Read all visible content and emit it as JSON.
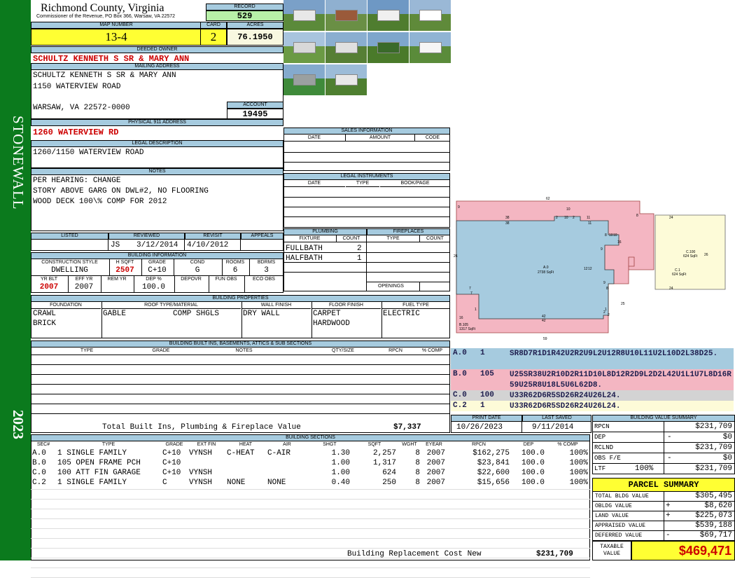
{
  "sidebar": {
    "district": "STONEWALL",
    "year": "2023"
  },
  "county": {
    "title": "Richmond County, Virginia",
    "subtitle": "Commissioner of the Revenue, PO Box 366, Warsaw, VA 22572"
  },
  "record": {
    "label": "RECORD",
    "value": "529"
  },
  "map": {
    "label": "MAP NUMBER",
    "value": "13-4"
  },
  "card": {
    "label": "CARD",
    "value": "2"
  },
  "acres": {
    "label": "ACRES",
    "value": "76.1950"
  },
  "owner": {
    "label": "DEEDED OWNER",
    "value": "SCHULTZ KENNETH S SR & MARY ANN"
  },
  "mailing": {
    "label": "MAILING ADDRESS",
    "line1": "SCHULTZ KENNETH S SR & MARY ANN",
    "line2": "1150 WATERVIEW ROAD",
    "line3": "WARSAW, VA 22572-0000"
  },
  "account": {
    "label": "ACCOUNT",
    "value": "19495"
  },
  "address911": {
    "label": "PHYSICAL 911 ADDRESS",
    "value": "1260 WATERVIEW RD"
  },
  "legal": {
    "label": "LEGAL DESCRIPTION",
    "value": "1260/1150  WATERVIEW ROAD"
  },
  "notes": {
    "label": "NOTES",
    "line1": "PER HEARING: CHANGE",
    "line2": "STORY ABOVE GARG ON DWL#2, NO FLOORING",
    "line3": "WOOD DECK 100\\% COMP FOR 2012"
  },
  "dates": {
    "listed_label": "LISTED",
    "reviewed_label": "REVIEWED",
    "revisit_label": "REVISIT",
    "appeals_label": "APPEALS",
    "reviewer": "JS",
    "reviewed": "3/12/2014",
    "revisit": "4/10/2012"
  },
  "building_info": {
    "label": "BUILDING INFORMATION",
    "h": [
      "CONSTRUCTION STYLE",
      "H SQFT",
      "GRADE",
      "COND",
      "ROOMS",
      "BDRMS"
    ],
    "v": [
      "DWELLING",
      "2507",
      "C+10",
      "G",
      "6",
      "3"
    ],
    "h2": [
      "YR BLT",
      "EFF YR",
      "REM YR",
      "DEP %",
      "DEPOVR",
      "FUN OBS",
      "ECO OBS"
    ],
    "v2": [
      "2007",
      "2007",
      "",
      "100.0",
      "",
      "",
      ""
    ]
  },
  "sales": {
    "label": "SALES INFORMATION",
    "h": [
      "DATE",
      "AMOUNT",
      "CODE"
    ]
  },
  "instruments": {
    "label": "LEGAL INSTRUMENTS",
    "h": [
      "DATE",
      "TYPE",
      "BOOK/PAGE"
    ]
  },
  "plumbing": {
    "label": "PLUMBING",
    "h": [
      "FIXTURE",
      "COUNT"
    ],
    "rows": [
      {
        "fixture": "FULLBATH",
        "count": "2"
      },
      {
        "fixture": "HALFBATH",
        "count": "1"
      }
    ]
  },
  "fireplaces": {
    "label": "FIREPLACES",
    "h": [
      "TYPE",
      "COUNT"
    ],
    "openings": "OPENINGS"
  },
  "properties": {
    "label": "BUILDING PROPERTIES",
    "h": [
      "FOUNDATION",
      "ROOF TYPE/MATERIAL",
      "WALL FINISH",
      "FLOOR FINISH",
      "FUEL TYPE"
    ],
    "foundation": [
      "CRAWL",
      "BRICK"
    ],
    "roof_type": "GABLE",
    "roof_mat": "COMP SHGLS",
    "wall": "DRY WALL",
    "floor": [
      "CARPET",
      "HARDWOOD"
    ],
    "fuel": "ELECTRIC"
  },
  "builtins": {
    "label": "BUILDING BUILT INS, BASEMENTS, ATTICS & SUB SECTIONS",
    "h": [
      "TYPE",
      "GRADE",
      "NOTES",
      "QTY/SIZE",
      "RPCN",
      "% COMP"
    ],
    "total_label": "Total Built Ins, Plumbing & Fireplace Value",
    "total": "$7,337"
  },
  "print": {
    "print_label": "PRINT DATE",
    "saved_label": "LAST SAVED",
    "print_date": "10/26/2023",
    "last_saved": "9/11/2014"
  },
  "sections": {
    "label": "BUILDING SECTIONS",
    "h": [
      "SEC#",
      "TYPE",
      "GRADE",
      "EXT FIN",
      "HEAT",
      "AIR",
      "SHGT",
      "SQFT",
      "WGHT",
      "EYEAR",
      "RPCN",
      "DEP",
      "% COMP"
    ],
    "rows": [
      [
        "A.0",
        "1 SINGLE FAMILY",
        "C+10",
        "VYNSH",
        "C-HEAT",
        "C-AIR",
        "1.30",
        "2,257",
        "8",
        "2007",
        "$162,275",
        "100.0",
        "100%"
      ],
      [
        "B.0",
        "105 OPEN FRAME PCH",
        "C+10",
        "",
        "",
        "",
        "1.00",
        "1,317",
        "8",
        "2007",
        "$23,841",
        "100.0",
        "100%"
      ],
      [
        "C.0",
        "100 ATT FIN GARAGE",
        "C+10",
        "VYNSH",
        "",
        "",
        "1.00",
        "624",
        "8",
        "2007",
        "$22,600",
        "100.0",
        "100%"
      ],
      [
        "C.2",
        "1 SINGLE FAMILY",
        "C",
        "VYNSH",
        "NONE",
        "NONE",
        "0.40",
        "250",
        "8",
        "2007",
        "$15,656",
        "100.0",
        "100%"
      ]
    ],
    "replacement_label": "Building Replacement Cost New",
    "replacement": "$231,709"
  },
  "sketch_codes": [
    {
      "sec": "A.0",
      "n": "1",
      "code": "SR8D7R1D1R42U2R2U9L2U12R8U10L11U2L10D2L38D25.",
      "color": "#a6cbdf"
    },
    {
      "sec": "B.0",
      "n": "105",
      "code": "U25SR38U2R10D2R11D10L8D12R2D9L2D2L42U1L1U7L8D16R59U25R8U18L5U6L62D8.",
      "color": "#f4b6c2"
    },
    {
      "sec": "C.0",
      "n": "100",
      "code": "U33R62D6R5SD26R24U26L24.",
      "color": "#d3d3d3"
    },
    {
      "sec": "C.2",
      "n": "1",
      "code": "U33R62D6R5SD26R24U26L24.",
      "color": "#fdfbd8"
    }
  ],
  "sketch": {
    "a_label": "A.0",
    "a_area": "2738 SqFt",
    "b_label": "B.105",
    "b_area": "1317 SqFt",
    "c_label": "C.100",
    "c_area": "624 SqFt",
    "c2_label": "C.1",
    "c2_area": "624 SqFt",
    "dims": [
      "62",
      "10",
      "9",
      "38",
      "38",
      "2",
      "10",
      "2",
      "11",
      "11",
      "8",
      "24",
      "10",
      "10",
      "16",
      "26",
      "26",
      "8",
      "9",
      "12",
      "12",
      "25",
      "9",
      "8",
      "7",
      "7",
      "2",
      "2",
      "1",
      "1",
      "42",
      "42",
      "16",
      "59",
      "24"
    ]
  },
  "value_summary": {
    "label": "BUILDING VALUE SUMMARY",
    "rows": [
      {
        "k": "RPCN",
        "op": "",
        "v": "$231,709"
      },
      {
        "k": "DEP",
        "op": "-",
        "v": "$0"
      },
      {
        "k": "RCLND",
        "op": "",
        "v": "$231,709"
      },
      {
        "k": "OBS F/E",
        "op": "-",
        "v": "$0"
      },
      {
        "k": "LTF",
        "op": "100%",
        "v": "$231,709"
      }
    ]
  },
  "parcel": {
    "label": "PARCEL SUMMARY",
    "rows": [
      {
        "k": "TOTAL BLDG VALUE",
        "op": "",
        "v": "$305,495"
      },
      {
        "k": "OBLDG VALUE",
        "op": "+",
        "v": "$8,620"
      },
      {
        "k": "LAND VALUE",
        "op": "+",
        "v": "$225,073"
      },
      {
        "k": "APPRAISED VALUE",
        "op": "",
        "v": "$539,188"
      },
      {
        "k": "DEFERRED VALUE",
        "op": "-",
        "v": "$69,717"
      }
    ],
    "taxable_label": "TAXABLE VALUE",
    "taxable": "$469,471"
  },
  "colors": {
    "header": "#a6cbdf",
    "sidebar": "#0b7a1d",
    "yellow": "#ffff33",
    "record_green": "#b8f0a8"
  }
}
